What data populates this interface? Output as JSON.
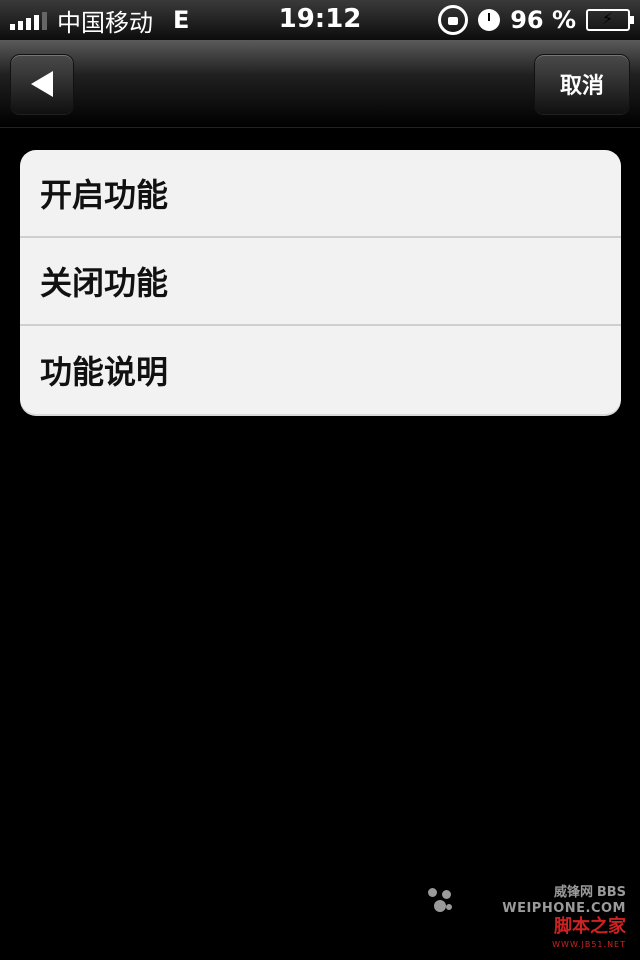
{
  "status_bar": {
    "carrier": "中国移动",
    "network": "E",
    "time": "19:12",
    "battery_percent": "96 %",
    "icons": [
      "signal-icon",
      "rotation-lock-icon",
      "alarm-icon",
      "battery-charging-icon"
    ]
  },
  "nav": {
    "back_icon": "back-arrow-icon",
    "cancel_label": "取消"
  },
  "menu": {
    "items": [
      {
        "label": "开启功能"
      },
      {
        "label": "关闭功能"
      },
      {
        "label": "功能说明"
      }
    ]
  },
  "watermark": {
    "site_cn": "威锋网",
    "bbs": "BBS",
    "site_en": "WEIPHONE.COM",
    "home": "脚本之家",
    "url": "WWW.JB51.NET"
  },
  "colors": {
    "background": "#000000",
    "list_background": "#f2f2f2",
    "list_text": "#111111",
    "watermark_red": "#cc2222"
  }
}
